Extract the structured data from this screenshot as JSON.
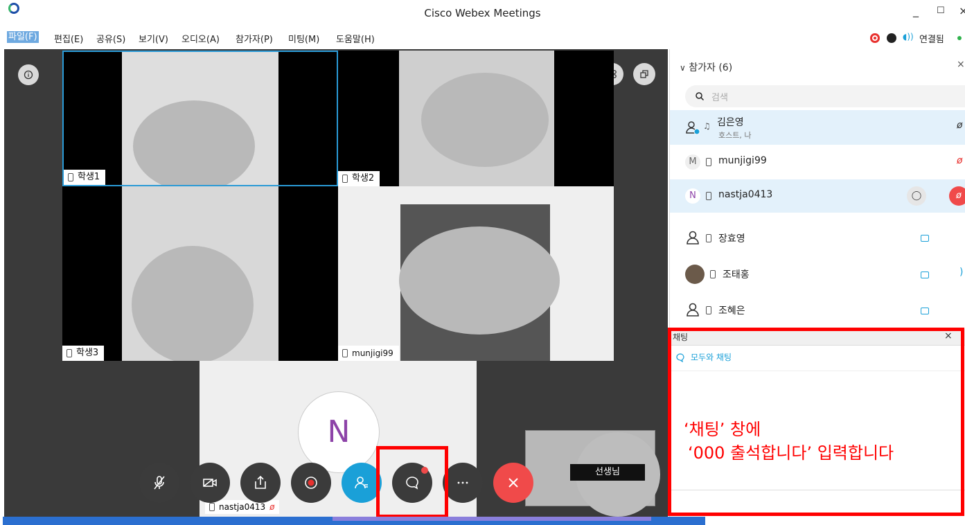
{
  "window": {
    "title": "Cisco Webex Meetings",
    "minimize": "_",
    "maximize": "☐",
    "close": "×"
  },
  "menu": [
    {
      "label": "파일(F)"
    },
    {
      "label": "편집(E)"
    },
    {
      "label": "공유(S)"
    },
    {
      "label": "보기(V)"
    },
    {
      "label": "오디오(A)"
    },
    {
      "label": "참가자(P)"
    },
    {
      "label": "미팅(M)"
    },
    {
      "label": "도움말(H)"
    }
  ],
  "status": {
    "connected_label": "연결됨"
  },
  "tiles": [
    {
      "label": "학생1"
    },
    {
      "label": "학생2"
    },
    {
      "label": "학생3"
    },
    {
      "label": "munjigi99"
    }
  ],
  "self_view": {
    "initial": "N",
    "name": "nastja0413"
  },
  "host_preview": {
    "label": "선생님"
  },
  "participants": {
    "header": "참가자 (6)",
    "search_placeholder": "검색",
    "list": [
      {
        "name": "김은영",
        "sub": "호스트, 나",
        "avatar": ""
      },
      {
        "name": "munjigi99",
        "sub": "",
        "avatar": "M"
      },
      {
        "name": "nastja0413",
        "sub": "",
        "avatar": "N"
      },
      {
        "name": "장효영",
        "sub": "",
        "avatar": ""
      },
      {
        "name": "조태홍",
        "sub": "",
        "avatar": ""
      },
      {
        "name": "조혜은",
        "sub": "",
        "avatar": ""
      }
    ]
  },
  "chat": {
    "title": "채팅",
    "close": "×",
    "to_label": "모두와 채팅",
    "annotation_line1": "‘채팅’ 창에",
    "annotation_line2": "‘000 출석합니다’ 입력합니다"
  },
  "colors": {
    "accent": "#1aa0d8",
    "annotation": "#ff0000",
    "end_call": "#f04a4a",
    "stage": "#3a3a3a"
  }
}
